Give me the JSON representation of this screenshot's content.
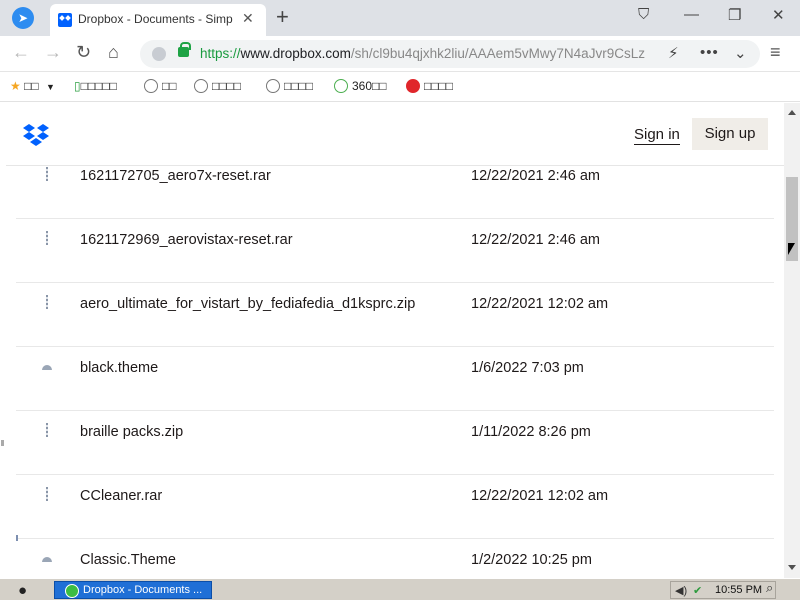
{
  "browser": {
    "tab_title": "Dropbox - Documents - Simp",
    "url_scheme": "https://",
    "url_host": "www.dropbox.com",
    "url_path": "/sh/cl9bu4qjxhk2liu/AAAem5vMwy7N4aJvr9CsLz",
    "icons": [
      "browser-logo",
      "back",
      "forward",
      "reload",
      "home",
      "lightning",
      "more",
      "dropdown",
      "menu"
    ]
  },
  "bookmarks": [
    {
      "label": "□□",
      "icon": "star-icon"
    },
    {
      "label": "□□□□□",
      "icon": "phone-icon"
    },
    {
      "label": "□□",
      "icon": "globe-icon"
    },
    {
      "label": "□□□□",
      "icon": "globe-icon"
    },
    {
      "label": "□□□□",
      "icon": "globe-icon"
    },
    {
      "label": "360□□",
      "icon": "ring-icon"
    },
    {
      "label": "□□□□",
      "icon": "weibo-icon"
    }
  ],
  "header": {
    "signin": "Sign in",
    "signup": "Sign up"
  },
  "files": [
    {
      "name": "1621172705_aero7x-reset.rar",
      "date": "12/22/2021 2:46 am",
      "icon": "zip-icon"
    },
    {
      "name": "1621172969_aerovistax-reset.rar",
      "date": "12/22/2021 2:46 am",
      "icon": "zip-icon"
    },
    {
      "name": "aero_ultimate_for_vistart_by_fediafedia_d1ksprc.zip",
      "date": "12/22/2021 12:02 am",
      "icon": "zip-icon"
    },
    {
      "name": "black.theme",
      "date": "1/6/2022 7:03 pm",
      "icon": "theme-icon"
    },
    {
      "name": "braille packs.zip",
      "date": "1/11/2022 8:26 pm",
      "icon": "zip-icon"
    },
    {
      "name": "CCleaner.rar",
      "date": "12/22/2021 12:02 am",
      "icon": "zip-icon"
    },
    {
      "name": "Classic.Theme",
      "date": "1/2/2022 10:25 pm",
      "icon": "theme-icon"
    }
  ],
  "taskbar": {
    "task_label": "Dropbox - Documents ...",
    "clock": "10:55 PM"
  }
}
